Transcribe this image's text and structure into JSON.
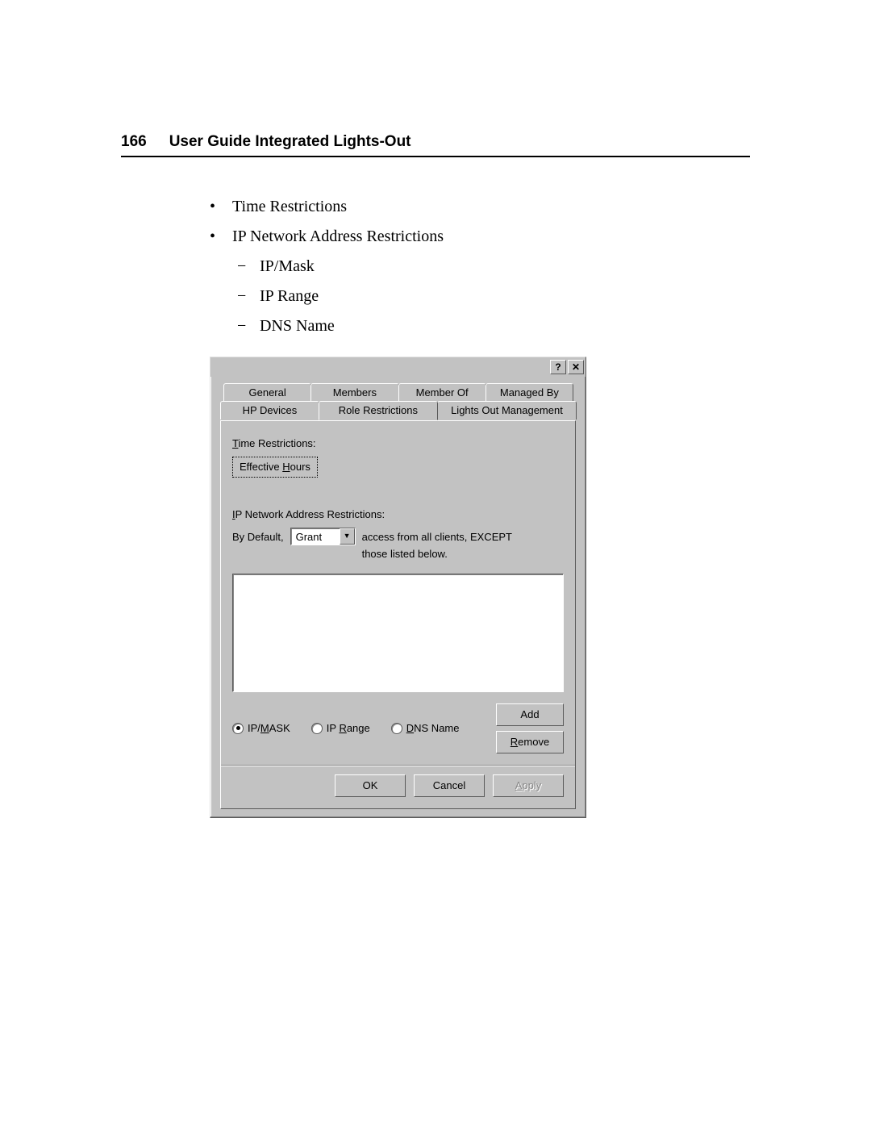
{
  "header": {
    "page_number": "166",
    "title": "User Guide Integrated Lights-Out"
  },
  "bullets": {
    "item1": "Time Restrictions",
    "item2": "IP Network Address Restrictions",
    "sub1": "IP/Mask",
    "sub2": "IP Range",
    "sub3": "DNS Name"
  },
  "dialog": {
    "titlebar": {
      "help": "?",
      "close": "✕"
    },
    "tabs_back": [
      "General",
      "Members",
      "Member Of",
      "Managed By"
    ],
    "tabs_front": [
      "HP Devices",
      "Role Restrictions",
      "Lights Out Management"
    ],
    "time_label": "Time Restrictions:",
    "effective_hours": "Effective Hours",
    "ip_label": "IP Network Address Restrictions:",
    "by_default": "By Default,",
    "combo_value": "Grant",
    "access_text1": "access from all clients, EXCEPT",
    "access_text2": "those listed below.",
    "radio_ipmask_pre": "IP/",
    "radio_ipmask_u": "M",
    "radio_ipmask_post": "ASK",
    "radio_iprange_pre": "IP ",
    "radio_iprange_u": "R",
    "radio_iprange_post": "ange",
    "radio_dns_u": "D",
    "radio_dns_post": "NS Name",
    "btn_add": "Add",
    "btn_remove_u": "R",
    "btn_remove_post": "emove",
    "btn_ok": "OK",
    "btn_cancel": "Cancel",
    "btn_apply_u": "A",
    "btn_apply_post": "pply"
  }
}
